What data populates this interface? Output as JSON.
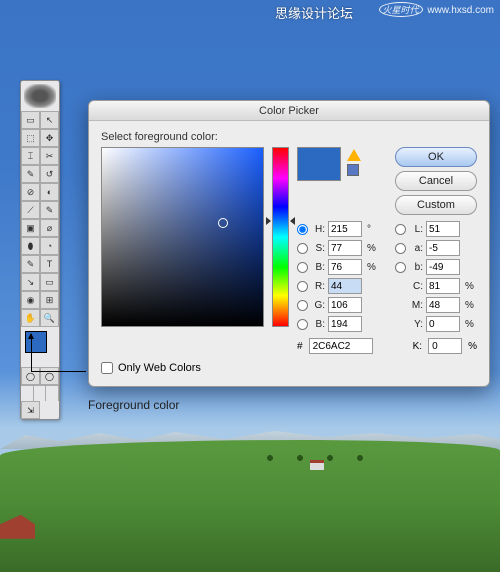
{
  "watermark": {
    "text1": "思缘设计论坛",
    "text2": "火星时代",
    "url": "www.hxsd.com"
  },
  "annotation": {
    "label": "Foreground color"
  },
  "toolbar": {
    "tools": [
      "▭",
      "↖",
      "⬚",
      "✥",
      "⌶",
      "✂",
      "✎",
      "↺",
      "⊘",
      "◐",
      "⟋",
      "✎",
      "▣",
      "⌀",
      "⬮",
      "◔",
      "✎",
      "T",
      "↘",
      "▭",
      "◉",
      "⊞",
      "✋",
      "🔍"
    ],
    "fg_color": "#2C6AC2",
    "bg_color": "#FFFFFF"
  },
  "dialog": {
    "title": "Color Picker",
    "prompt": "Select foreground color:",
    "buttons": {
      "ok": "OK",
      "cancel": "Cancel",
      "custom": "Custom"
    },
    "only_web": "Only Web Colors",
    "fields": {
      "H": "215",
      "S": "77",
      "B": "76",
      "R": "44",
      "G": "106",
      "Bb": "194",
      "L": "51",
      "a": "-5",
      "b": "-49",
      "C": "81",
      "M": "48",
      "Y": "0",
      "K": "0",
      "hex": "2C6AC2"
    },
    "units": {
      "deg": "°",
      "pct": "%"
    },
    "labels": {
      "H": "H:",
      "S": "S:",
      "B": "B:",
      "R": "R:",
      "G": "G:",
      "Bb": "B:",
      "L": "L:",
      "a": "a:",
      "b": "b:",
      "C": "C:",
      "M": "M:",
      "Y": "Y:",
      "K": "K:",
      "hash": "#"
    }
  }
}
